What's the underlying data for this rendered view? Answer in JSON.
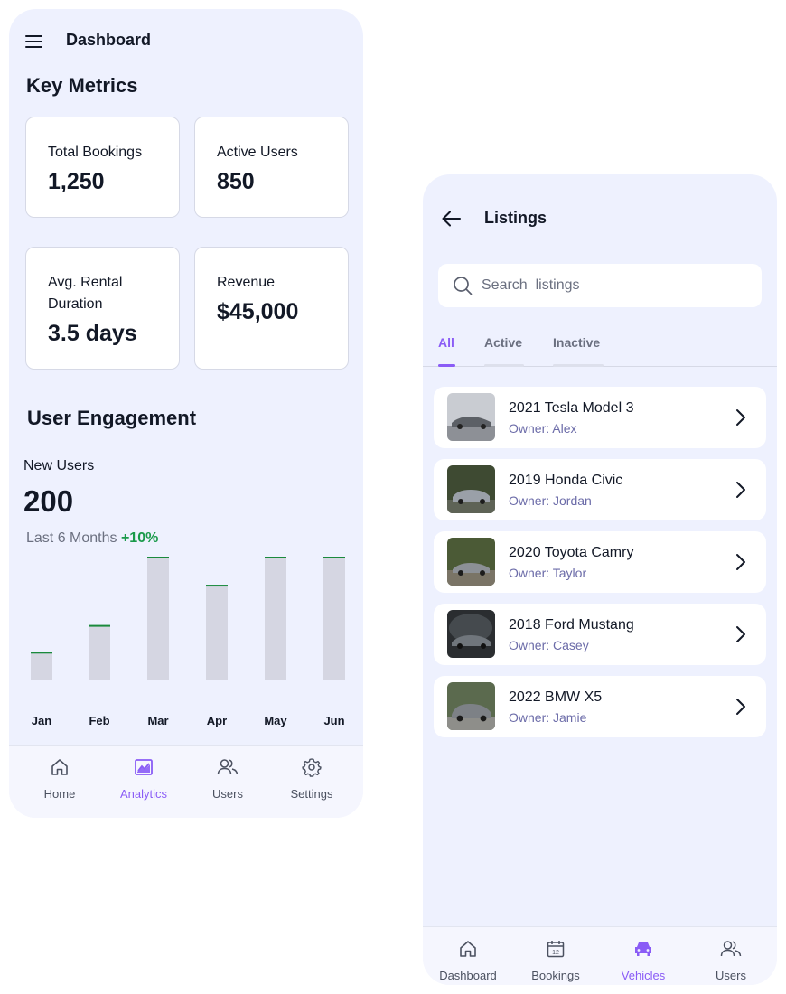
{
  "dashboard": {
    "header": {
      "title": "Dashboard"
    },
    "key_metrics": {
      "title": "Key Metrics",
      "cards": [
        {
          "label": "Total Bookings",
          "value": "1,250"
        },
        {
          "label": "Active Users",
          "value": "850"
        },
        {
          "label": "Avg. Rental Duration",
          "value": "3.5 days"
        },
        {
          "label": "Revenue",
          "value": "$45,000"
        }
      ]
    },
    "engagement": {
      "title": "User Engagement",
      "label": "New Users",
      "value": "200",
      "period": "Last 6 Months",
      "change": "+10%"
    },
    "nav": [
      {
        "label": "Home",
        "icon": "home-icon"
      },
      {
        "label": "Analytics",
        "icon": "chart-icon",
        "active": true
      },
      {
        "label": "Users",
        "icon": "users-icon"
      },
      {
        "label": "Settings",
        "icon": "gear-icon"
      }
    ]
  },
  "chart_data": {
    "type": "bar",
    "categories": [
      "Jan",
      "Feb",
      "Mar",
      "Apr",
      "May",
      "Jun"
    ],
    "values": [
      22,
      44,
      100,
      77,
      100,
      100
    ],
    "ylim": [
      0,
      100
    ],
    "grid": false,
    "bar_color": "#d5d6e2",
    "top_line_color": "#1a8a3c"
  },
  "listings": {
    "header": {
      "title": "Listings"
    },
    "search": {
      "placeholder": "Search  listings",
      "value": ""
    },
    "tabs": [
      {
        "label": "All",
        "active": true
      },
      {
        "label": "Active"
      },
      {
        "label": "Inactive"
      }
    ],
    "items": [
      {
        "title": "2021 Tesla Model 3",
        "owner": "Owner: Alex"
      },
      {
        "title": "2019 Honda Civic",
        "owner": "Owner: Jordan"
      },
      {
        "title": "2020 Toyota Camry",
        "owner": "Owner: Taylor"
      },
      {
        "title": "2018 Ford Mustang",
        "owner": "Owner: Casey"
      },
      {
        "title": "2022 BMW X5",
        "owner": "Owner: Jamie"
      }
    ],
    "nav": [
      {
        "label": "Dashboard",
        "icon": "home-icon"
      },
      {
        "label": "Bookings",
        "icon": "calendar-icon"
      },
      {
        "label": "Vehicles",
        "icon": "car-icon",
        "active": true
      },
      {
        "label": "Users",
        "icon": "users-icon"
      }
    ]
  },
  "colors": {
    "accent": "#8a5cf6",
    "positive": "#1a9a4a",
    "background": "#eef1fe"
  }
}
